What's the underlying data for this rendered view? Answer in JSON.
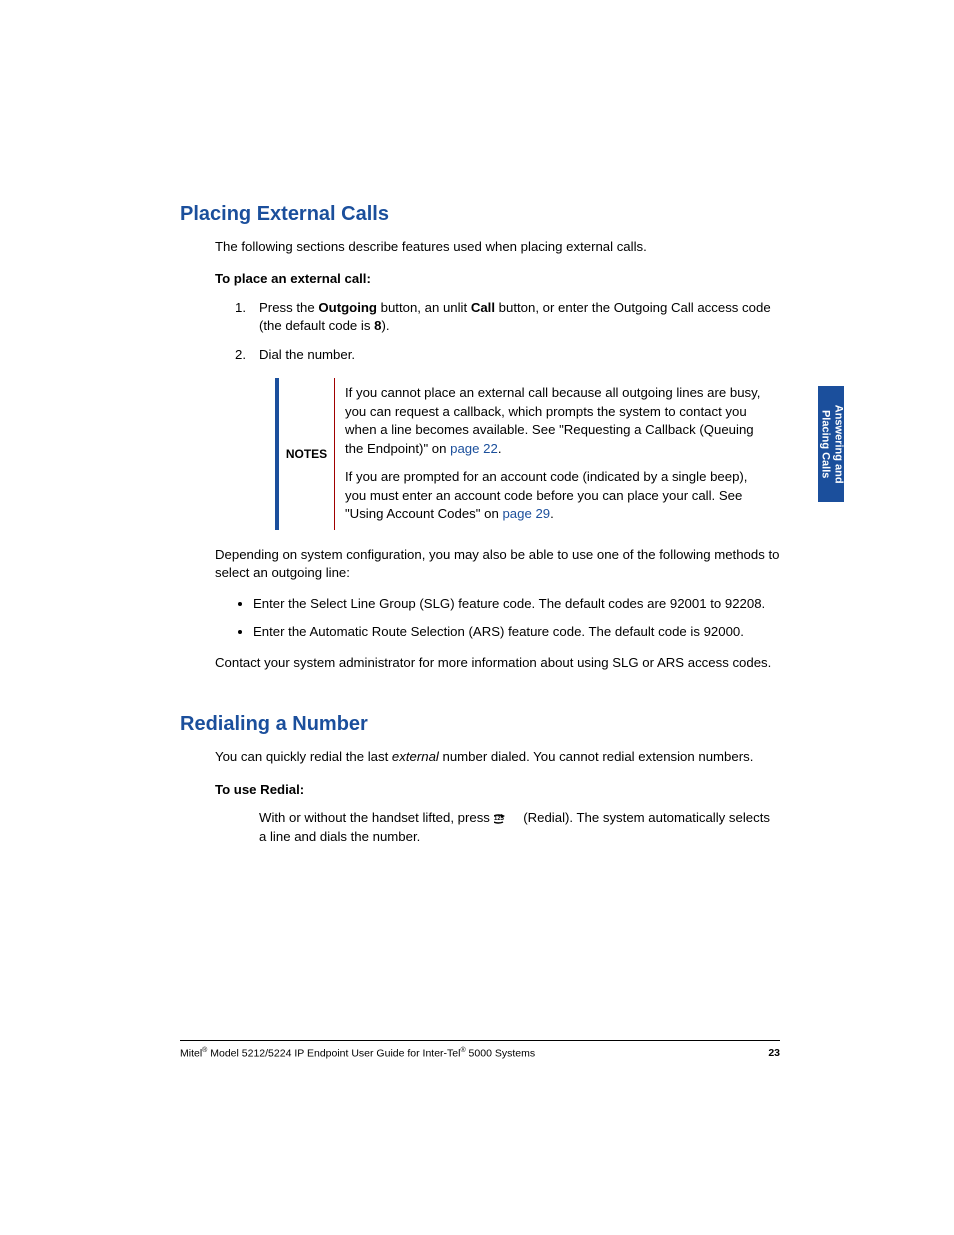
{
  "section1": {
    "heading": "Placing External Calls",
    "intro": "The following sections describe features used when placing external calls.",
    "subhead": "To place an external call:",
    "step1": {
      "num": "1.",
      "a": "Press the ",
      "b1": "Outgoing",
      "b": " button, an unlit ",
      "b2": "Call",
      "c": " button, or enter the Outgoing Call access code (the default code is ",
      "b3": "8",
      "d": ")."
    },
    "step2": {
      "num": "2.",
      "text": "Dial the number."
    },
    "notesLabel": "NOTES",
    "note1": {
      "a": "If you cannot place an external call because all outgoing lines are busy, you can request a callback, which prompts the system to contact you when a line becomes available. See \"Requesting a Callback (Queuing the Endpoint)\" on ",
      "link": "page 22",
      "b": "."
    },
    "note2": {
      "a": "If you are prompted for an account code (indicated by a single beep), you must enter an account code before you can place your call. See \"Using Account Codes\" on ",
      "link": "page 29",
      "b": "."
    },
    "para2": "Depending on system configuration, you may also be able to use one of the following methods to select an outgoing line:",
    "bullet1": "Enter the Select Line Group (SLG) feature code. The default codes are 92001 to 92208.",
    "bullet2": "Enter the Automatic Route Selection (ARS) feature code. The default code is 92000.",
    "para3": "Contact your system administrator for more information about using SLG or ARS access codes."
  },
  "section2": {
    "heading": "Redialing a Number",
    "intro_a": "You can quickly redial the last ",
    "intro_em": "external",
    "intro_b": " number dialed.  You cannot redial extension numbers.",
    "subhead": "To use Redial:",
    "step_a": "With or without the handset lifted, press ",
    "step_b": " (Redial). The system automatically selects a line and dials the number."
  },
  "sideTab": {
    "line1": "Answering and",
    "line2": "Placing Calls"
  },
  "footer": {
    "brand1": "Mitel",
    "mid": " Model 5212/5224 IP Endpoint User Guide for Inter-Tel",
    "tail": " 5000 Systems",
    "page": "23"
  }
}
